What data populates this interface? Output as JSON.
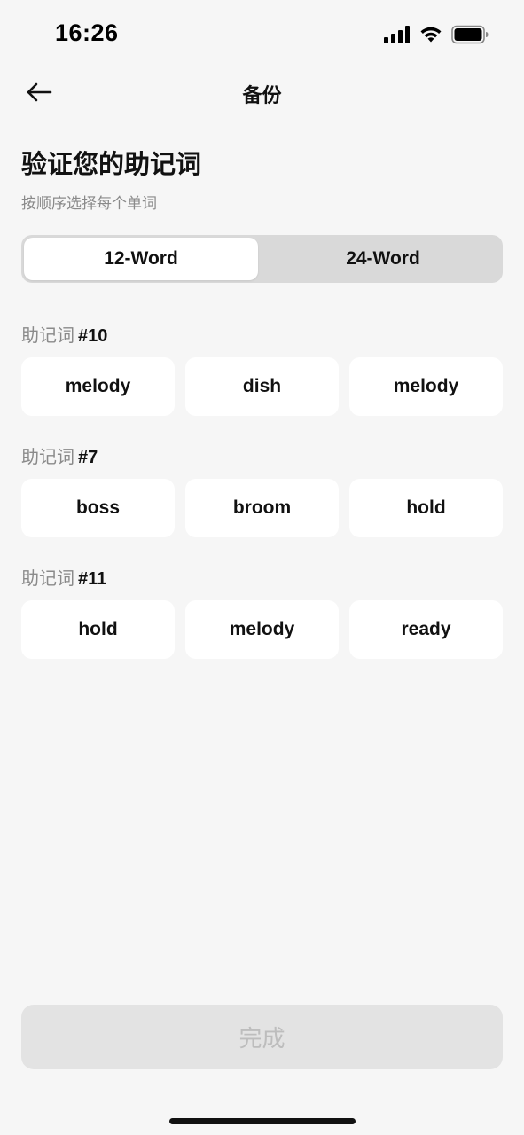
{
  "status_bar": {
    "time": "16:26"
  },
  "nav": {
    "title": "备份"
  },
  "page": {
    "heading": "验证您的助记词",
    "subtitle": "按顺序选择每个单词"
  },
  "segmented": {
    "options": [
      "12-Word",
      "24-Word"
    ],
    "selected": "12-Word"
  },
  "groups": [
    {
      "label": "助记词",
      "number": "#10",
      "options": [
        "melody",
        "dish",
        "melody"
      ]
    },
    {
      "label": "助记词",
      "number": "#7",
      "options": [
        "boss",
        "broom",
        "hold"
      ]
    },
    {
      "label": "助记词",
      "number": "#11",
      "options": [
        "hold",
        "melody",
        "ready"
      ]
    }
  ],
  "footer": {
    "done_label": "完成"
  },
  "colors": {
    "background": "#f6f6f6",
    "card": "#ffffff",
    "segment_track": "#d9d9d9",
    "disabled_button": "#e3e3e3",
    "disabled_text": "#bdbdbd",
    "muted_text": "#8a8a8a"
  },
  "icons": {
    "back": "arrow-left-icon",
    "signal": "cellular-signal-icon",
    "wifi": "wifi-icon",
    "battery": "battery-icon"
  }
}
